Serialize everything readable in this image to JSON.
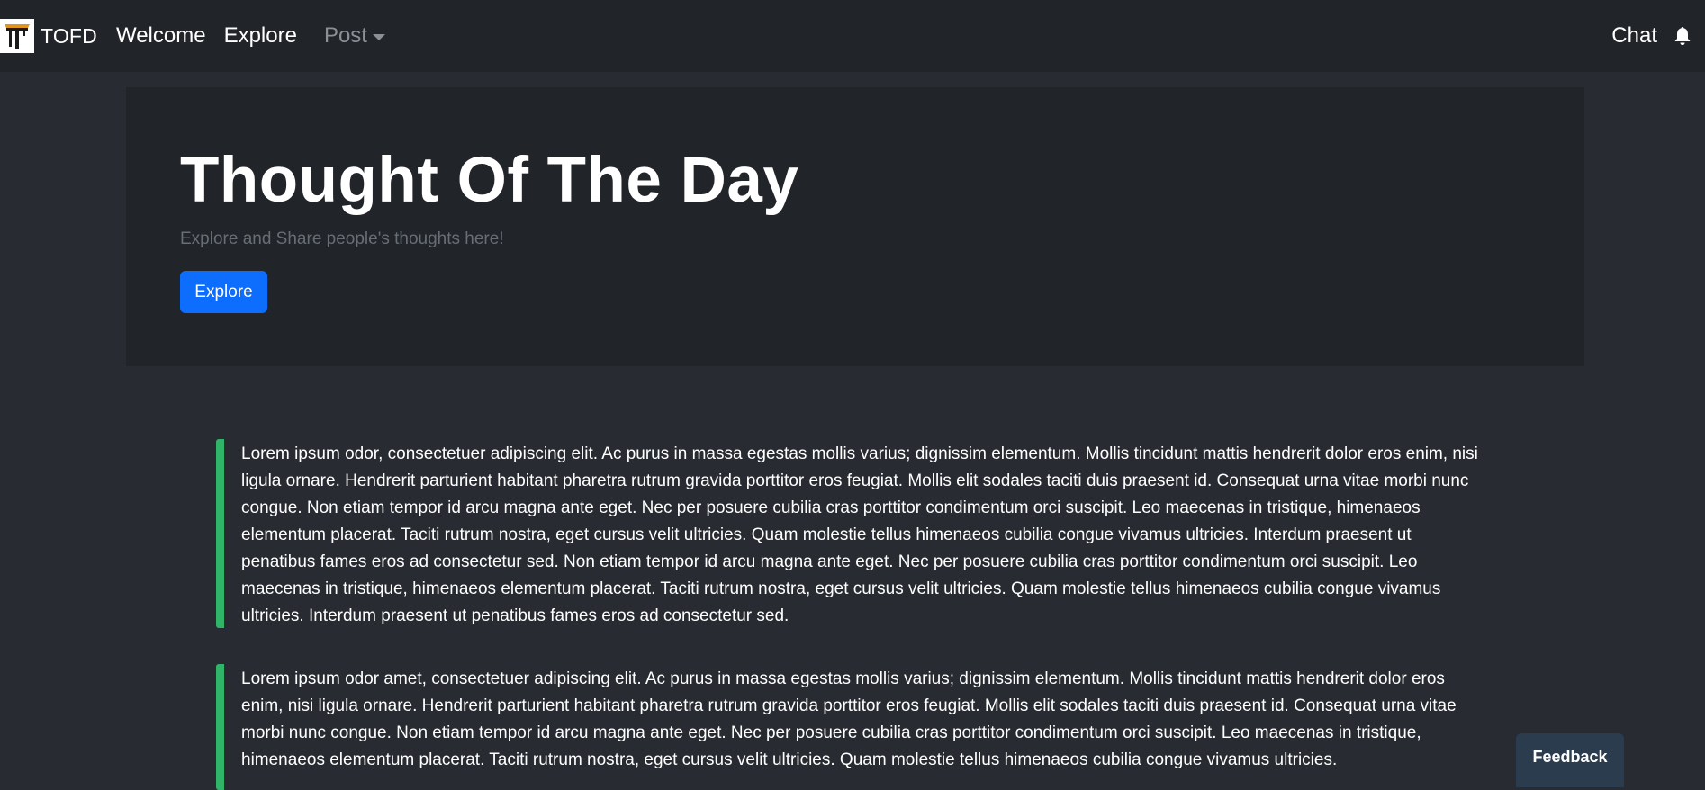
{
  "nav": {
    "brand": "TOFD",
    "links": [
      {
        "label": "Welcome"
      },
      {
        "label": "Explore"
      },
      {
        "label": "Post"
      }
    ],
    "chat": "Chat"
  },
  "hero": {
    "title": "Thought Of The Day",
    "subtitle": "Explore and Share people's thoughts here!",
    "button": "Explore"
  },
  "quotes": [
    "Lorem ipsum odor, consectetuer adipiscing elit. Ac purus in massa egestas mollis varius; dignissim elementum. Mollis tincidunt mattis hendrerit dolor eros enim, nisi ligula ornare. Hendrerit parturient habitant pharetra rutrum gravida porttitor eros feugiat. Mollis elit sodales taciti duis praesent id. Consequat urna vitae morbi nunc congue. Non etiam tempor id arcu magna ante eget. Nec per posuere cubilia cras porttitor condimentum orci suscipit. Leo maecenas in tristique, himenaeos elementum placerat. Taciti rutrum nostra, eget cursus velit ultricies. Quam molestie tellus himenaeos cubilia congue vivamus ultricies. Interdum praesent ut penatibus fames eros ad consectetur sed. Non etiam tempor id arcu magna ante eget. Nec per posuere cubilia cras porttitor condimentum orci suscipit. Leo maecenas in tristique, himenaeos elementum placerat. Taciti rutrum nostra, eget cursus velit ultricies. Quam molestie tellus himenaeos cubilia congue vivamus ultricies. Interdum praesent ut penatibus fames eros ad consectetur sed.",
    "Lorem ipsum odor amet, consectetuer adipiscing elit. Ac purus in massa egestas mollis varius; dignissim elementum. Mollis tincidunt mattis hendrerit dolor eros enim, nisi ligula ornare. Hendrerit parturient habitant pharetra rutrum gravida porttitor eros feugiat. Mollis elit sodales taciti duis praesent id. Consequat urna vitae morbi nunc congue. Non etiam tempor id arcu magna ante eget. Nec per posuere cubilia cras porttitor condimentum orci suscipit. Leo maecenas in tristique, himenaeos elementum placerat. Taciti rutrum nostra, eget cursus velit ultricies. Quam molestie tellus himenaeos cubilia congue vivamus ultricies."
  ],
  "feedback": "Feedback",
  "colors": {
    "background": "#282c32",
    "navbar": "#212529",
    "hero": "#212429",
    "primary": "#0d6efd",
    "quote_border": "#2fb468",
    "feedback_tab": "#2b3c4e"
  },
  "icons": {
    "logo": "tofd-logo",
    "post_dropdown": "chevron-down-icon",
    "notifications": "bell-icon"
  }
}
